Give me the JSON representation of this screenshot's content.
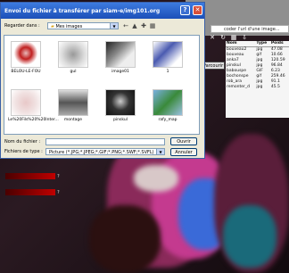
{
  "dialog": {
    "title": "Envoi du fichier à transférer par siam-e/img101.org",
    "look_in_label": "Regarder dans :",
    "look_in_value": "Mes images",
    "files": [
      {
        "name": "BELOU-LE-FOU"
      },
      {
        "name": "gul"
      },
      {
        "name": "image01"
      },
      {
        "name": "1"
      },
      {
        "name": "Le%20Fils%20%20Inter..."
      },
      {
        "name": "montage"
      },
      {
        "name": "pinskul"
      },
      {
        "name": "rafy_map"
      }
    ],
    "filename_label": "Nom du fichier :",
    "filetype_label": "Fichiers de type :",
    "filetype_value": "Picture (*.JPG;*.JPEG;*.GIF;*.PNG;*.SWF;*.SVFL)",
    "open_button": "Ouvrir",
    "cancel_button": "Annuler"
  },
  "address_bar": "coder l'url d'une image...",
  "browse_button": "Parcourir",
  "table": {
    "headers": [
      "Nom",
      "Type",
      "Poids"
    ],
    "rows": [
      [
        "bouveau2",
        "jpg",
        "47.08"
      ],
      [
        "bouveau",
        "gif",
        "10.66"
      ],
      [
        "anka7",
        "jpg",
        "120.59"
      ],
      [
        "pinskul",
        "jpg",
        "96.84"
      ],
      [
        "babouspe",
        "GIF",
        "6.23"
      ],
      [
        "bochonspe",
        "gif",
        "259.46"
      ],
      [
        "rob_ara",
        "jpg",
        "91.1"
      ],
      [
        "remonter_d",
        "jpg",
        "45.5"
      ]
    ]
  },
  "left_panel": {
    "labels": [
      "?",
      "?"
    ]
  }
}
